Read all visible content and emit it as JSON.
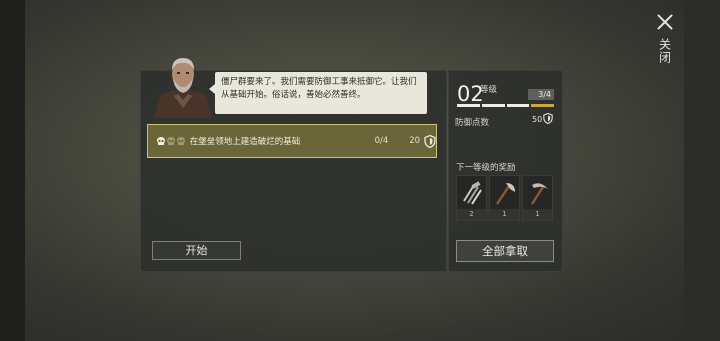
{
  "close": {
    "label": "关闭"
  },
  "dialogue": {
    "text": "僵尸群要来了。我们需要防御工事来抵御它。让我们从基础开始。俗话说，善始必然善终。"
  },
  "task": {
    "text": "在堡垒领地上建造破烂的基础",
    "progress": "0/4",
    "points": "20"
  },
  "start_button": {
    "label": "开始"
  },
  "level": {
    "number": "02",
    "label": "等级",
    "progress": "3/4",
    "progress_fraction": 0.75
  },
  "defense": {
    "label": "防御点数",
    "value": "50"
  },
  "rewards": {
    "title": "下一等级的奖励",
    "items": [
      {
        "icon": "metal-parts-icon",
        "count": "2"
      },
      {
        "icon": "axe-icon",
        "count": "1"
      },
      {
        "icon": "pickaxe-icon",
        "count": "1"
      }
    ]
  },
  "claim_button": {
    "label": "全部拿取"
  },
  "colors": {
    "task_bg": "#6a6639",
    "task_border": "#cfc27a",
    "progress_accent": "#c9a73c"
  }
}
